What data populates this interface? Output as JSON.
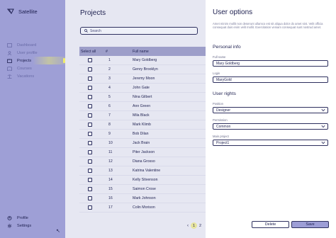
{
  "app": {
    "name": "Satellite"
  },
  "sidebar": {
    "items": [
      {
        "label": "Dashboard",
        "icon": "dashboard-icon"
      },
      {
        "label": "User profile",
        "icon": "user-icon"
      },
      {
        "label": "Projects",
        "icon": "projects-icon",
        "active": true
      },
      {
        "label": "Courses",
        "icon": "courses-icon"
      },
      {
        "label": "Vacations",
        "icon": "vacations-icon"
      }
    ],
    "bottom": [
      {
        "label": "Profile",
        "icon": "profile-icon"
      },
      {
        "label": "Settings",
        "icon": "settings-icon"
      }
    ],
    "collapse_glyph": "↖"
  },
  "main": {
    "title": "Projects",
    "search_placeholder": "Search",
    "table": {
      "columns": [
        "Select all",
        "#",
        "Full name"
      ],
      "rows": [
        {
          "n": "1",
          "name": "Mary Goldberg"
        },
        {
          "n": "2",
          "name": "Genry Brooklyn"
        },
        {
          "n": "3",
          "name": "Jeremy Moon"
        },
        {
          "n": "4",
          "name": "John Gate"
        },
        {
          "n": "5",
          "name": "Nina Gilbert"
        },
        {
          "n": "6",
          "name": "Ann Green"
        },
        {
          "n": "7",
          "name": "Mila Black"
        },
        {
          "n": "8",
          "name": "Mark Klimb"
        },
        {
          "n": "9",
          "name": "Bob Dilan"
        },
        {
          "n": "10",
          "name": "Jack Brain"
        },
        {
          "n": "11",
          "name": "Piter Jackson"
        },
        {
          "n": "12",
          "name": "Diana Grosso"
        },
        {
          "n": "13",
          "name": "Katrina Valentine"
        },
        {
          "n": "14",
          "name": "Kelly Stivenson"
        },
        {
          "n": "15",
          "name": "Saimon Crose"
        },
        {
          "n": "16",
          "name": "Mark Johnson"
        },
        {
          "n": "17",
          "name": "Colin Morison"
        }
      ]
    },
    "pager": {
      "prev": "‹",
      "current": "1",
      "next": "2"
    }
  },
  "panel": {
    "title": "User options",
    "description": "Amet minim mollit non deserunt ullamco est sit aliqua dolor do amet sint. Velit officia consequat duis enim velit mollit. Exercitation veniam consequat sunt nostrud amet.",
    "personal_info": "Personal info",
    "full_name_label": "Full name",
    "full_name_value": "Mary Goldberg",
    "login_label": "Login",
    "login_value": "MaryGold",
    "user_rights": "User rights",
    "position_label": "Position",
    "position_value": "Designer",
    "permission_label": "Permission",
    "permission_value": "Common",
    "main_project_label": "Main project",
    "main_project_value": "Project1",
    "delete_label": "Delete",
    "save_label": "Save"
  },
  "colors": {
    "sidebar": "#9e9fd6",
    "header": "#9d9ec9",
    "accent": "#f2ee6a",
    "text": "#1e2050"
  }
}
